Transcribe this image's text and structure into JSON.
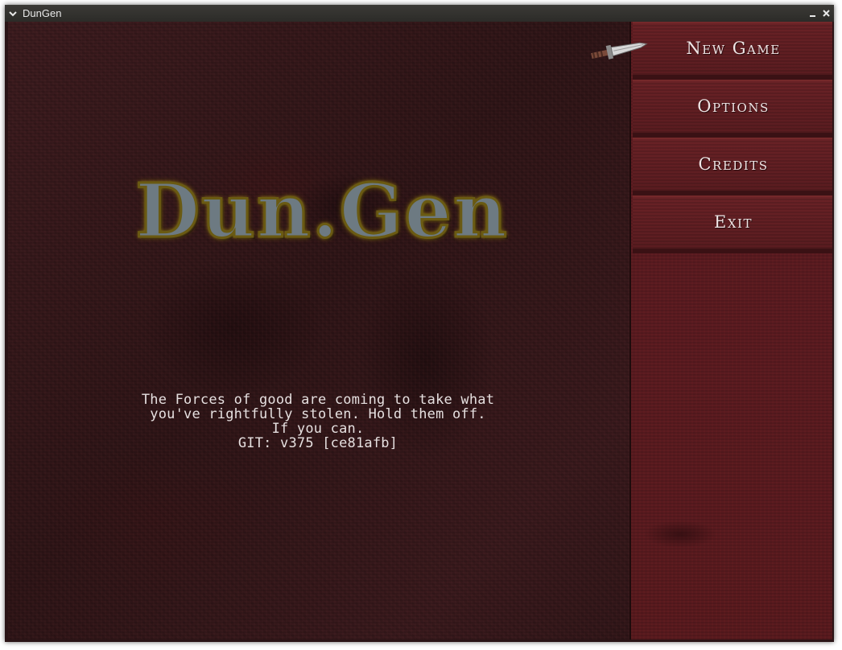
{
  "window": {
    "title": "DunGen"
  },
  "logo": {
    "text": "Dun.Gen"
  },
  "tagline": {
    "lines": [
      "The Forces of good are coming to take what",
      "you've rightfully stolen. Hold them off.",
      "If you can.",
      "GIT: v375 [ce81afb]"
    ]
  },
  "menu": {
    "items": [
      {
        "label": "New Game"
      },
      {
        "label": "Options"
      },
      {
        "label": "Credits"
      },
      {
        "label": "Exit"
      }
    ]
  },
  "icons": {
    "window_menu": "chevron-down-icon",
    "minimize": "minimize-icon",
    "close": "close-icon",
    "cursor": "dagger-cursor-icon"
  },
  "colors": {
    "menu_bg": "#5a1b20",
    "button_border": "#3a1114",
    "logo_outline": "#b59a18",
    "text": "#e6e0e0"
  }
}
